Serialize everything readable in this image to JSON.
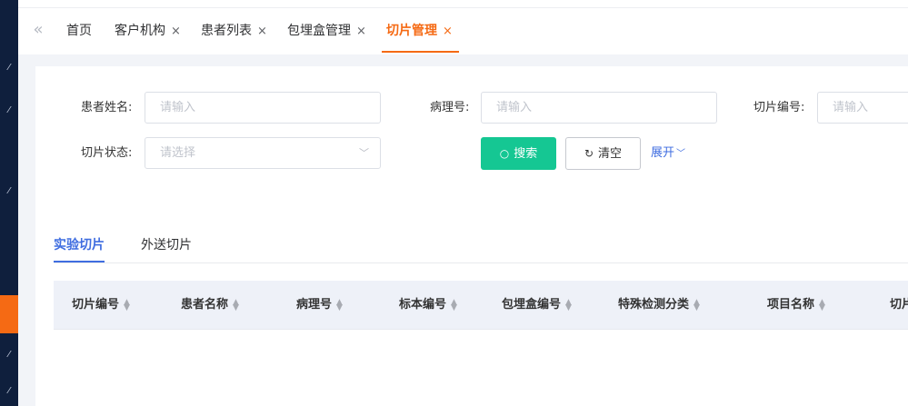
{
  "tabs": {
    "collapse_icon": "double-chevron-left-icon",
    "items": [
      {
        "label": "首页"
      },
      {
        "label": "客户机构",
        "close": "×"
      },
      {
        "label": "患者列表",
        "close": "×"
      },
      {
        "label": "包埋盒管理",
        "close": "×"
      },
      {
        "label": "切片管理",
        "close": "×",
        "active": true
      }
    ]
  },
  "search_form": {
    "patient_name": {
      "label": "患者姓名:",
      "placeholder": "请输入"
    },
    "pathology_no": {
      "label": "病理号:",
      "placeholder": "请输入"
    },
    "slice_no": {
      "label": "切片编号:",
      "placeholder": "请输入"
    },
    "slice_status": {
      "label": "切片状态:",
      "placeholder": "请选择"
    },
    "search_button": "搜索",
    "clear_button": "清空",
    "expand_link": "展开"
  },
  "sub_tabs": [
    {
      "label": "实验切片",
      "active": true
    },
    {
      "label": "外送切片"
    }
  ],
  "table": {
    "columns": [
      "切片编号",
      "患者名称",
      "病理号",
      "标本编号",
      "包埋盒编号",
      "特殊检测分类",
      "项目名称",
      "切片"
    ]
  },
  "colors": {
    "sidebar": "#0f1f3d",
    "accent_orange": "#f56a14",
    "search_green": "#15c793",
    "link_blue": "#3f6de0"
  }
}
